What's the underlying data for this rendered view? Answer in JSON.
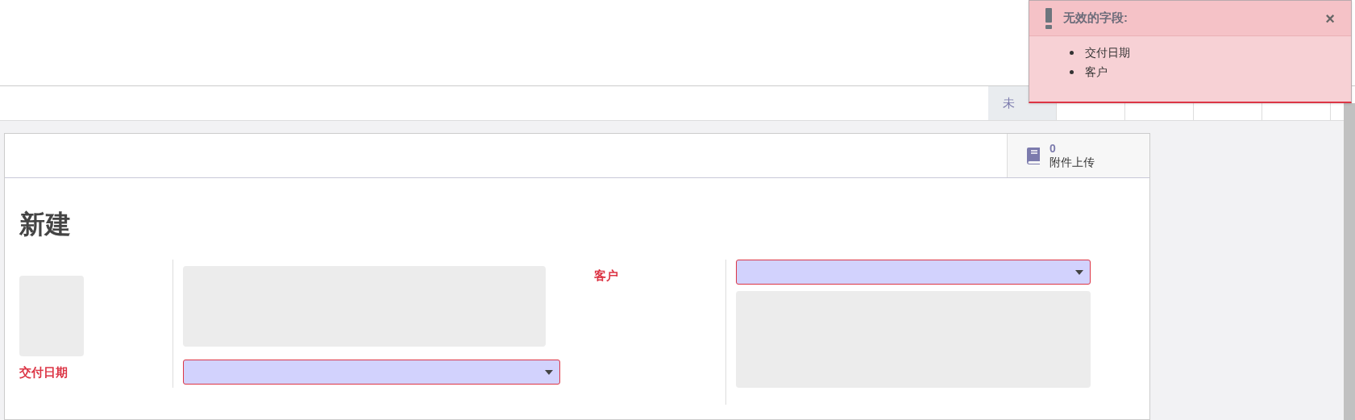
{
  "status_bar": {
    "stages": [
      {
        "label": "未",
        "selected": true
      },
      {
        "selected": false
      },
      {
        "selected": false
      },
      {
        "selected": false
      },
      {
        "selected": false
      }
    ]
  },
  "button_box": {
    "count": "0",
    "label": "附件上传"
  },
  "form": {
    "title": "新建",
    "fields": [
      {
        "label": "交付日期",
        "invalid": true
      },
      {
        "label": "客户",
        "invalid": true
      }
    ]
  },
  "notification": {
    "title": "无效的字段:",
    "close": "×",
    "items": [
      "交付日期",
      "客户"
    ]
  }
}
